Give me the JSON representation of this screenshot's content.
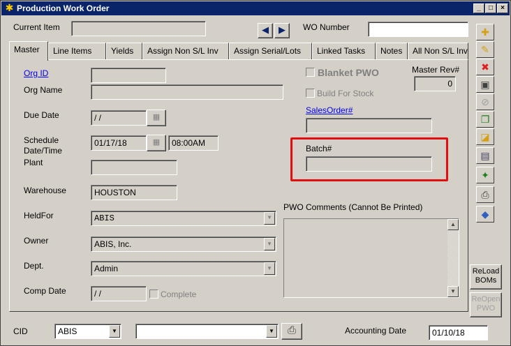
{
  "window": {
    "title": "Production Work Order"
  },
  "header": {
    "current_item_label": "Current Item",
    "current_item_value": "",
    "wo_number_label": "WO Number",
    "wo_number_value": ""
  },
  "tabs": [
    {
      "label": "Master",
      "active": true
    },
    {
      "label": "Line Items"
    },
    {
      "label": "Yields"
    },
    {
      "label": "Assign  Non S/L Inv"
    },
    {
      "label": "Assign Serial/Lots"
    },
    {
      "label": "Linked Tasks"
    },
    {
      "label": "Notes"
    },
    {
      "label": "All Non S/L Inv"
    }
  ],
  "master": {
    "org_id_label": "Org ID",
    "org_id_value": "",
    "org_name_label": "Org Name",
    "org_name_value": "",
    "due_date_label": "Due Date",
    "due_date_value": "/ /",
    "schedule_label_1": "Schedule",
    "schedule_label_2": "Date/Time",
    "schedule_date_value": "01/17/18",
    "schedule_time_value": "08:00AM",
    "plant_label": "Plant",
    "plant_value": "",
    "warehouse_label": "Warehouse",
    "warehouse_value": "HOUSTON",
    "held_for_label": "HeldFor",
    "held_for_value": "ABIS",
    "owner_label": "Owner",
    "owner_value": "ABIS, Inc.",
    "dept_label": "Dept.",
    "dept_value": "Admin",
    "comp_date_label": "Comp Date",
    "comp_date_value": "/ /",
    "complete_label": "Complete",
    "blanket_pwo_label": "Blanket PWO",
    "build_for_stock_label": "Build For Stock",
    "master_rev_label": "Master Rev#",
    "master_rev_value": "0",
    "sales_order_label": "SalesOrder#",
    "sales_order_value": "",
    "batch_label": "Batch#",
    "batch_value": "",
    "pwo_comments_label": "PWO Comments  (Cannot Be Printed)",
    "pwo_comments_value": ""
  },
  "sidebar": {
    "icons": [
      "new-icon",
      "edit-icon",
      "delete-icon",
      "save-icon",
      "cancel-icon",
      "copy-icon",
      "note-icon",
      "image-icon",
      "tools-icon",
      "print-icon",
      "tag-icon"
    ],
    "reload_boms_line1": "ReLoad",
    "reload_boms_line2": "BOMs",
    "reopen_pwo_line1": "ReOpen",
    "reopen_pwo_line2": "PWO"
  },
  "footer": {
    "cid_label": "CID",
    "cid_value": "ABIS",
    "cid2_value": "",
    "accounting_date_label": "Accounting Date",
    "accounting_date_value": "01/10/18"
  },
  "colors": {
    "titlebar": "#0a246a",
    "highlight": "#e01010",
    "link": "#0000ee"
  }
}
